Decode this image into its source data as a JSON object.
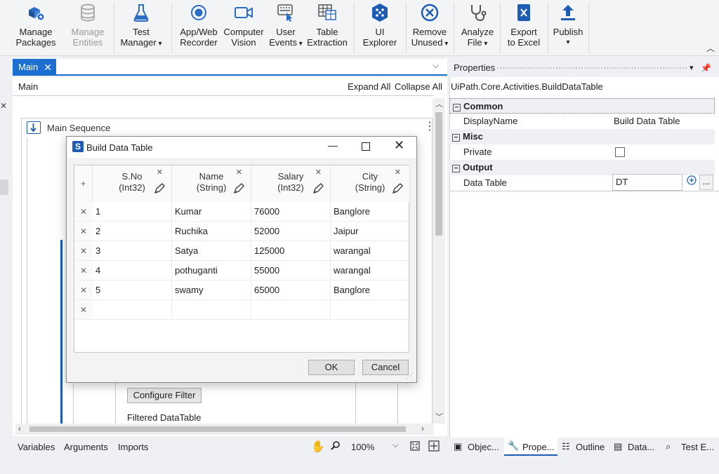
{
  "ribbon": {
    "manage_packages": "Manage\nPackages",
    "manage_entities": "Manage\nEntities",
    "test_manager": "Test\nManager",
    "app_web_recorder": "App/Web\nRecorder",
    "computer_vision": "Computer\nVision",
    "user_events": "User\nEvents",
    "table_extraction": "Table\nExtraction",
    "ui_explorer": "UI\nExplorer",
    "remove_unused": "Remove\nUnused",
    "analyze_file": "Analyze\nFile",
    "export_to_excel": "Export\nto Excel",
    "publish": "Publish"
  },
  "doc": {
    "tab_label": "Main",
    "breadcrumb": "Main",
    "expand_all": "Expand All",
    "collapse_all": "Collapse All",
    "sequence_title": "Main Sequence",
    "configure_filter": "Configure Filter",
    "filtered_label": "Filtered DataTable"
  },
  "bottom": {
    "variables": "Variables",
    "arguments": "Arguments",
    "imports": "Imports",
    "zoom": "100%"
  },
  "properties": {
    "title": "Properties",
    "activity_type": "UiPath.Core.Activities.BuildDataTable",
    "groups": {
      "common": "Common",
      "misc": "Misc",
      "output": "Output"
    },
    "display_name_label": "DisplayName",
    "display_name_value": "Build Data Table",
    "private_label": "Private",
    "data_table_label": "Data Table",
    "data_table_value": "DT",
    "ellipsis": "..."
  },
  "right_tabs": {
    "objects": "Objec...",
    "properties": "Prope...",
    "outline": "Outline",
    "data": "Data...",
    "test": "Test E..."
  },
  "dialog": {
    "title": "Build Data Table",
    "columns": [
      {
        "name": "S.No",
        "type": "(Int32)"
      },
      {
        "name": "Name",
        "type": "(String)"
      },
      {
        "name": "Salary",
        "type": "(Int32)"
      },
      {
        "name": "City",
        "type": "(String)"
      }
    ],
    "rows": [
      [
        "1",
        "Kumar",
        "76000",
        "Banglore"
      ],
      [
        "2",
        "Ruchika",
        "52000",
        "Jaipur"
      ],
      [
        "3",
        "Satya",
        "125000",
        "warangal"
      ],
      [
        "4",
        "pothuganti",
        "55000",
        "warangal"
      ],
      [
        "5",
        "swamy",
        "65000",
        "Banglore"
      ]
    ],
    "ok": "OK",
    "cancel": "Cancel"
  }
}
